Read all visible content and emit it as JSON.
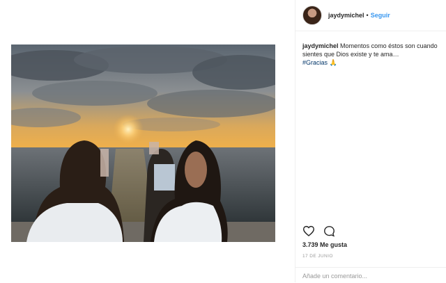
{
  "post": {
    "author": {
      "username": "jaydymichel",
      "separator": "•",
      "follow_label": "Seguir"
    },
    "caption": {
      "username": "jaydymichel",
      "text": "Momentos como éstos son cuando sientes que Dios existe y te ama…",
      "hashtag": "#Gracias",
      "emoji": "🙏"
    },
    "likes": "3.739 Me gusta",
    "date": "17 DE JUNIO",
    "comment": {
      "placeholder": "Añade un comentario..."
    },
    "icons": {
      "like": "heart-icon",
      "comment": "comment-bubble-icon"
    },
    "colors": {
      "link": "#3897f0",
      "hashtag": "#003569",
      "muted": "#999999",
      "text": "#262626"
    }
  }
}
